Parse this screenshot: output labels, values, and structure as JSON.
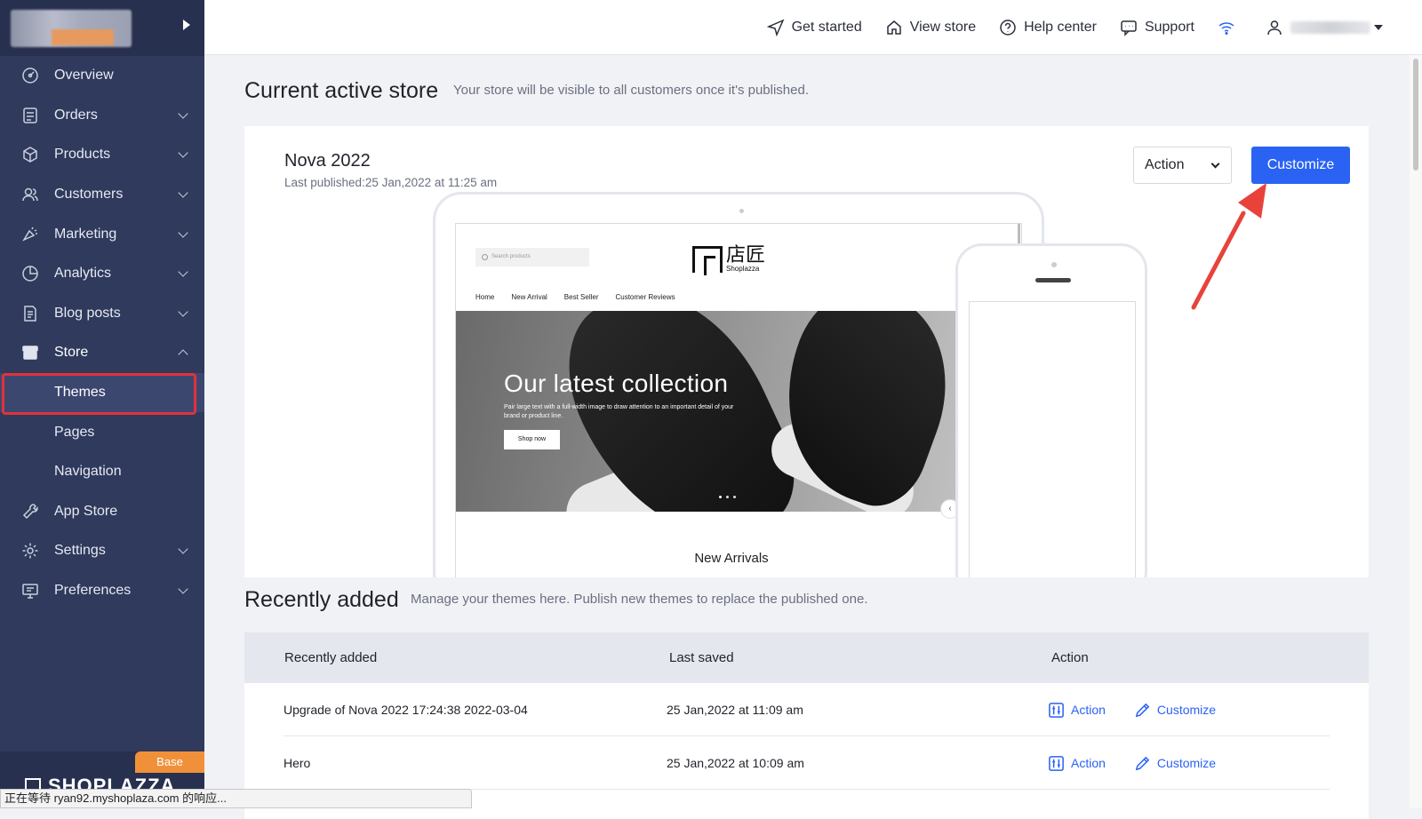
{
  "sidebar": {
    "menu": [
      {
        "label": "Overview",
        "icon": "dashboard-icon",
        "expandable": false
      },
      {
        "label": "Orders",
        "icon": "orders-icon",
        "expandable": true
      },
      {
        "label": "Products",
        "icon": "products-icon",
        "expandable": true
      },
      {
        "label": "Customers",
        "icon": "customers-icon",
        "expandable": true
      },
      {
        "label": "Marketing",
        "icon": "marketing-icon",
        "expandable": true
      },
      {
        "label": "Analytics",
        "icon": "analytics-icon",
        "expandable": true
      },
      {
        "label": "Blog posts",
        "icon": "blog-icon",
        "expandable": true
      },
      {
        "label": "Store",
        "icon": "store-icon",
        "expandable": true,
        "expanded": true
      },
      {
        "label": "Themes",
        "sub": true,
        "active": true
      },
      {
        "label": "Pages",
        "sub": true
      },
      {
        "label": "Navigation",
        "sub": true
      },
      {
        "label": "App Store",
        "icon": "app-store-icon",
        "expandable": false
      },
      {
        "label": "Settings",
        "icon": "gear-icon",
        "expandable": true
      },
      {
        "label": "Preferences",
        "icon": "preferences-icon",
        "expandable": true
      }
    ],
    "plan_badge": "Base",
    "brand": "SHOPLAZZA"
  },
  "statusbar": {
    "text": "正在等待 ryan92.myshoplaza.com 的响应..."
  },
  "topbar": {
    "get_started": "Get started",
    "view_store": "View store",
    "help_center": "Help center",
    "support": "Support"
  },
  "current": {
    "title": "Current active store",
    "subtitle": "Your store will be visible to all customers once it's published.",
    "theme_name": "Nova 2022",
    "last_published": "Last published:25 Jan,2022 at 11:25 am",
    "action_label": "Action",
    "customize_label": "Customize"
  },
  "preview": {
    "search_placeholder": "Search products",
    "logo_cn": "店匠",
    "logo_en": "Shoplazza",
    "nav": [
      "Home",
      "New Arrival",
      "Best Seller",
      "Customer Reviews"
    ],
    "hero_title": "Our latest collection",
    "hero_desc": "Pair large text with a full-width image to draw attention to an important detail of your brand or product line.",
    "hero_button": "Shop now",
    "section_title": "New Arrivals"
  },
  "recent": {
    "title": "Recently added",
    "subtitle": "Manage your themes here. Publish new themes to replace the published one.",
    "headers": [
      "Recently added",
      "Last saved",
      "Action"
    ],
    "rows": [
      {
        "name": "Upgrade of Nova 2022 17:24:38 2022-03-04",
        "saved": "25 Jan,2022 at 11:09 am",
        "action": "Action",
        "customize": "Customize"
      },
      {
        "name": "Hero",
        "saved": "25 Jan,2022 at 10:09 am",
        "action": "Action",
        "customize": "Customize"
      }
    ]
  },
  "colors": {
    "primary": "#2a62f4",
    "sidebar": "#2f3a5c",
    "highlight": "#e0323c",
    "badge": "#f0913a"
  }
}
